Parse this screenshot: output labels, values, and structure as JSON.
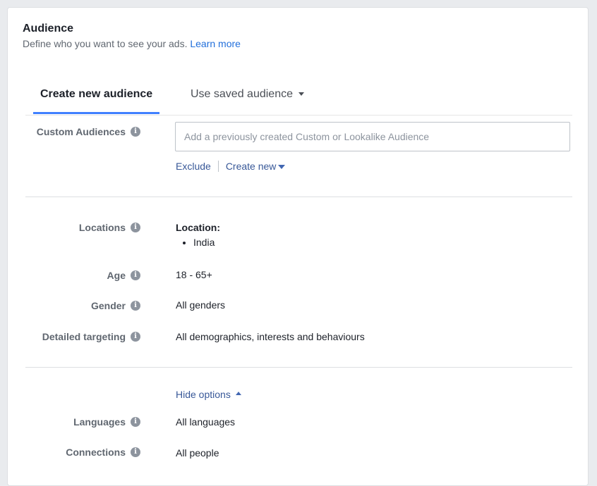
{
  "section": {
    "title": "Audience",
    "subtitle": "Define who you want to see your ads.",
    "learn_more": "Learn more"
  },
  "tabs": [
    {
      "label": "Create new audience",
      "active": true
    },
    {
      "label": "Use saved audience",
      "active": false
    }
  ],
  "custom_audiences": {
    "label": "Custom Audiences",
    "placeholder": "Add a previously created Custom or Lookalike Audience",
    "value": "",
    "exclude": "Exclude",
    "create_new": "Create new"
  },
  "locations": {
    "label": "Locations",
    "heading": "Location:",
    "items": [
      "India"
    ]
  },
  "age": {
    "label": "Age",
    "value": "18 - 65+"
  },
  "gender": {
    "label": "Gender",
    "value": "All genders"
  },
  "detailed_targeting": {
    "label": "Detailed targeting",
    "value": "All demographics, interests and behaviours"
  },
  "options": {
    "toggle_label": "Hide options"
  },
  "languages": {
    "label": "Languages",
    "value": "All languages"
  },
  "connections": {
    "label": "Connections",
    "value": "All people"
  },
  "icons": {
    "info": "info-icon",
    "dropdown": "caret-down-icon",
    "collapse": "caret-up-icon"
  },
  "colors": {
    "link": "#385898",
    "accent": "#4080ff",
    "label": "#606770"
  }
}
